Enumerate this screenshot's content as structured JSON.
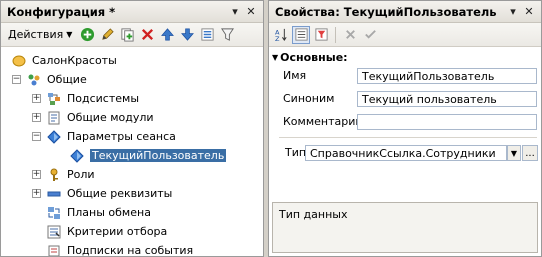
{
  "left_panel": {
    "title": "Конфигурация *",
    "close_glyph": "✕",
    "pin_glyph": "▾",
    "menu_label": "Действия",
    "tree": [
      {
        "label": "СалонКрасоты",
        "icon": "config-icon",
        "expander": ""
      },
      {
        "label": "Общие",
        "icon": "common-icon",
        "expander": "−"
      },
      {
        "label": "Подсистемы",
        "icon": "subsystems-icon",
        "expander": "+"
      },
      {
        "label": "Общие модули",
        "icon": "module-icon",
        "expander": "+"
      },
      {
        "label": "Параметры сеанса",
        "icon": "session-param-icon",
        "expander": "−"
      },
      {
        "label": "ТекущийПользователь",
        "icon": "session-param-icon",
        "expander": ""
      },
      {
        "label": "Роли",
        "icon": "roles-icon",
        "expander": "+"
      },
      {
        "label": "Общие реквизиты",
        "icon": "attributes-icon",
        "expander": "+"
      },
      {
        "label": "Планы обмена",
        "icon": "exchange-plans-icon",
        "expander": ""
      },
      {
        "label": "Критерии отбора",
        "icon": "filter-criteria-icon",
        "expander": ""
      },
      {
        "label": "Подписки на события",
        "icon": "event-subscriptions-icon",
        "expander": ""
      }
    ]
  },
  "right_panel": {
    "title": "Свойства: ТекущийПользователь",
    "close_glyph": "✕",
    "pin_glyph": "▾",
    "section_title": "Основные:",
    "fields": {
      "name_label": "Имя",
      "name_value": "ТекущийПользователь",
      "synonym_label": "Синоним",
      "synonym_value": "Текущий пользователь",
      "comment_label": "Комментарий",
      "comment_value": "",
      "type_label": "Тип",
      "type_value": "СправочникСсылка.Сотрудники",
      "type_more": "..."
    },
    "description": "Тип данных"
  },
  "colors": {
    "selection": "#3a6ea5",
    "accent_blue": "#1a4fa0",
    "add_green": "#2e9b2e",
    "delete_red": "#d02020"
  }
}
